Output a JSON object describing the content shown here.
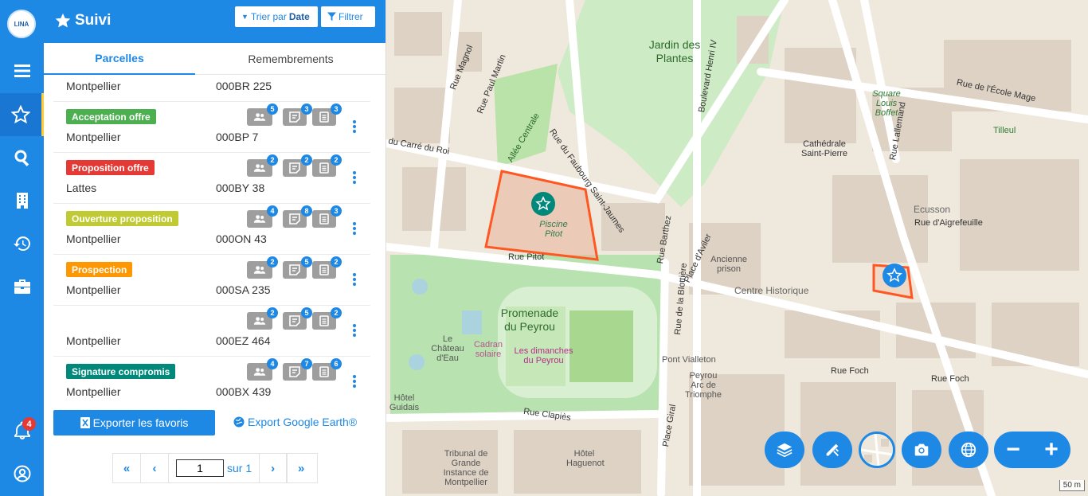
{
  "app": {
    "logo_text": "LINA"
  },
  "rail": {
    "notification_count": "4"
  },
  "header": {
    "title": "Suivi",
    "sort_prefix": "Trier par",
    "sort_value": "Date",
    "filter_label": "Filtrer"
  },
  "tabs": {
    "parcelles": "Parcelles",
    "remembrements": "Remembrements"
  },
  "rows": [
    {
      "badge": "",
      "city": "Montpellier",
      "ref": "000BR 225",
      "c1": "",
      "c2": "",
      "c3": ""
    },
    {
      "badge": "Acceptation offre",
      "color": "#4caf50",
      "city": "Montpellier",
      "ref": "000BP 7",
      "c1": "5",
      "c2": "3",
      "c3": "3"
    },
    {
      "badge": "Proposition offre",
      "color": "#e53935",
      "city": "Lattes",
      "ref": "000BY 38",
      "c1": "2",
      "c2": "2",
      "c3": "2"
    },
    {
      "badge": "Ouverture proposition",
      "color": "#c0ca33",
      "city": "Montpellier",
      "ref": "000ON 43",
      "c1": "4",
      "c2": "8",
      "c3": "3"
    },
    {
      "badge": "Prospection",
      "color": "#ff9800",
      "city": "Montpellier",
      "ref": "000SA 235",
      "c1": "2",
      "c2": "5",
      "c3": "2"
    },
    {
      "badge": "",
      "city": "Montpellier",
      "ref": "000EZ 464",
      "c1": "2",
      "c2": "5",
      "c3": "2"
    },
    {
      "badge": "Signature compromis",
      "color": "#00897b",
      "city": "Montpellier",
      "ref": "000BX 439",
      "c1": "4",
      "c2": "7",
      "c3": "6"
    }
  ],
  "footer": {
    "export_favoris": "Exporter les favoris",
    "export_google_earth": "Export Google Earth®"
  },
  "pager": {
    "current": "1",
    "of_label": "sur 1"
  },
  "map": {
    "labels": {
      "jardin": "Jardin des Plantes",
      "promenade": "Promenade du Peyrou",
      "piscine": "Piscine Pitot",
      "chateau": "Le Château d'Eau",
      "cadran": "Cadran solaire",
      "dimanches": "Les dimanches du Peyrou",
      "cathedrale": "Cathédrale Saint-Pierre",
      "prison": "Ancienne prison",
      "centre": "Centre Historique",
      "ecusson": "Ecusson",
      "square": "Square Louis Boffet",
      "tilleul": "Tilleul",
      "arc": "Peyrou Arc de Triomphe",
      "tribunal": "Tribunal de Grande Instance de Montpellier",
      "hotel_hag": "Hôtel Haguenot",
      "hotel_guidais": "Hôtel Guidais",
      "pont": "Pont Vialleton",
      "r_pitot": "Rue Pitot",
      "r_foch": "Rue Foch",
      "r_foch2": "Rue Foch",
      "r_clapies": "Rue Clapiès",
      "r_faubourg": "Rue du Faubourg Saint-Jaumes",
      "r_blvd": "Boulevard Henri IV",
      "r_carre": "du Carré du Roi",
      "r_magnol": "Rue Magnol",
      "r_martin": "Rue Paul Martin",
      "r_ecole": "Rue de l'École Mage",
      "r_aigref": "Rue d'Aigrefeuille",
      "r_lallemand": "Rue Lallemand",
      "r_barthez": "Rue Barthez",
      "r_blottiere": "Rue de la Blottière",
      "r_pl_aviler": "Place d'Aviler",
      "r_giral": "Place Giral",
      "allee": "Allée Centrale",
      "scale": "50 m"
    }
  }
}
